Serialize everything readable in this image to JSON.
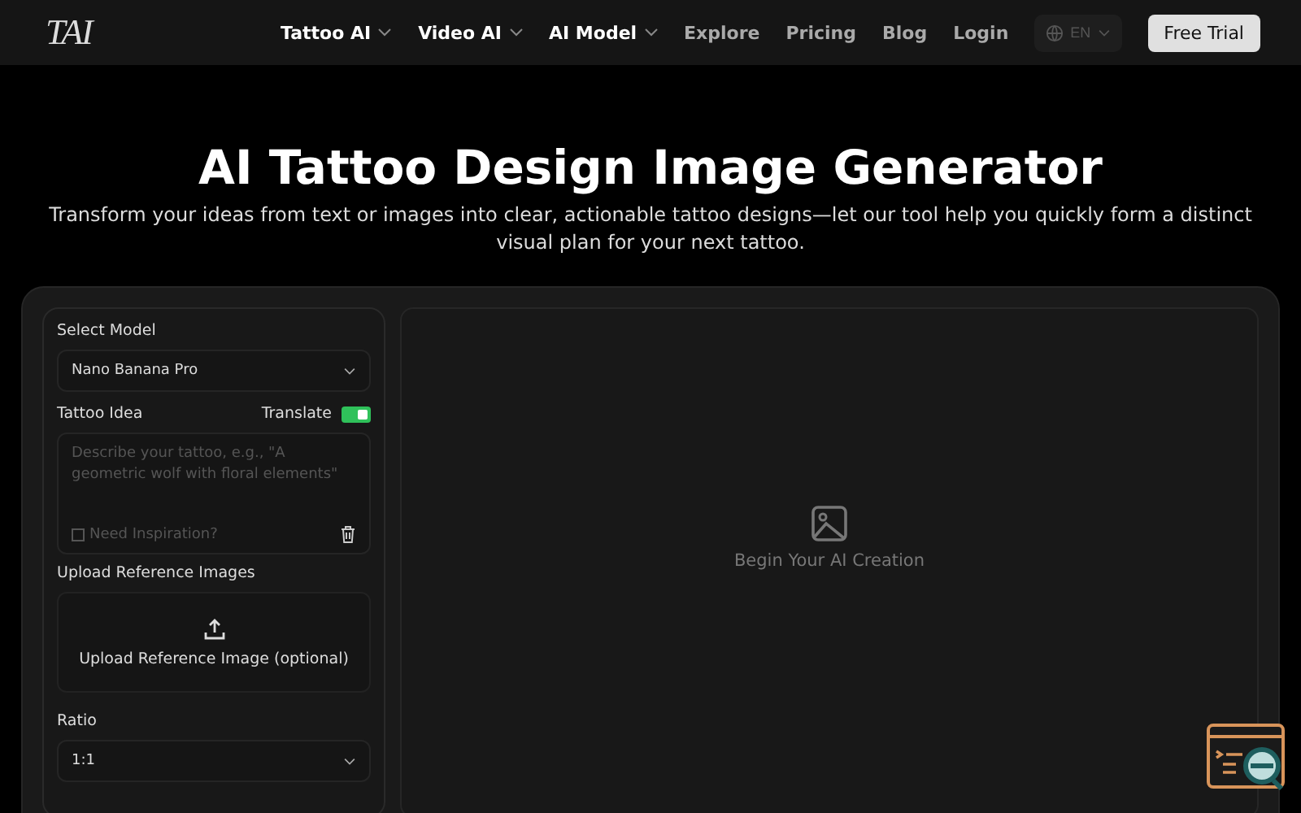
{
  "header": {
    "logo": "TAI",
    "nav": [
      {
        "label": "Tattoo AI",
        "dropdown": true
      },
      {
        "label": "Video AI",
        "dropdown": true
      },
      {
        "label": "AI Model",
        "dropdown": true
      },
      {
        "label": "Explore",
        "dropdown": false
      },
      {
        "label": "Pricing",
        "dropdown": false
      },
      {
        "label": "Blog",
        "dropdown": false
      },
      {
        "label": "Login",
        "dropdown": false
      }
    ],
    "language": "EN",
    "cta": "Free Trial"
  },
  "hero": {
    "title": "AI Tattoo Design Image Generator",
    "subtitle": "Transform your ideas from text or images into clear, actionable tattoo designs—let our tool help you quickly form a distinct visual plan for your next tattoo."
  },
  "form": {
    "model_label": "Select Model",
    "model_value": "Nano Banana Pro",
    "idea_label": "Tattoo Idea",
    "translate_label": "Translate",
    "translate_on": true,
    "idea_placeholder": "Describe your tattoo, e.g., \"A geometric wolf with floral elements\"",
    "inspiration_label": "Need Inspiration?",
    "inspiration_checked": false,
    "upload_label": "Upload Reference Images",
    "upload_button": "Upload Reference Image (optional)",
    "ratio_label": "Ratio",
    "ratio_value": "1:1"
  },
  "preview": {
    "empty_text": "Begin Your AI Creation"
  }
}
